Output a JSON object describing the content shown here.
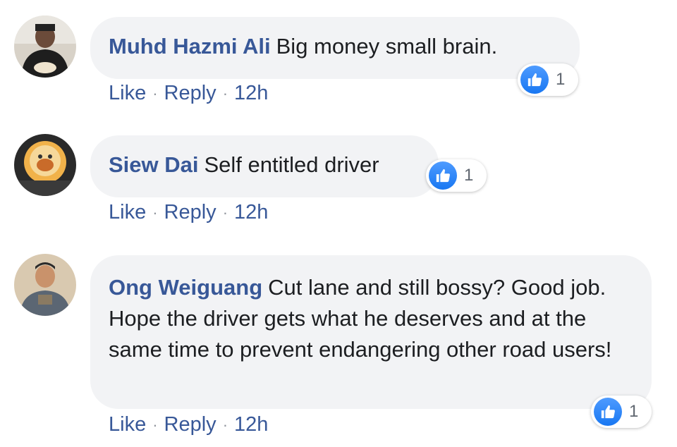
{
  "comments": [
    {
      "author": "Muhd Hazmi Ali",
      "text": "Big money small brain.",
      "reaction_count": "1",
      "like": "Like",
      "reply": "Reply",
      "sep": "·",
      "time": "12h"
    },
    {
      "author": "Siew Dai",
      "text": "Self entitled driver",
      "reaction_count": "1",
      "like": "Like",
      "reply": "Reply",
      "sep": "·",
      "time": "12h"
    },
    {
      "author": "Ong Weiguang",
      "text": "Cut lane and still bossy? Good job. Hope the driver gets what he deserves and at the same time to prevent endangering other road users!",
      "reaction_count": "1",
      "like": "Like",
      "reply": "Reply",
      "sep": "·",
      "time": "12h"
    }
  ],
  "colors": {
    "author": "#385898",
    "bubble": "#f2f3f5",
    "like_badge": "#1877f2"
  },
  "icons": [
    "like-thumb-icon",
    "avatar"
  ]
}
